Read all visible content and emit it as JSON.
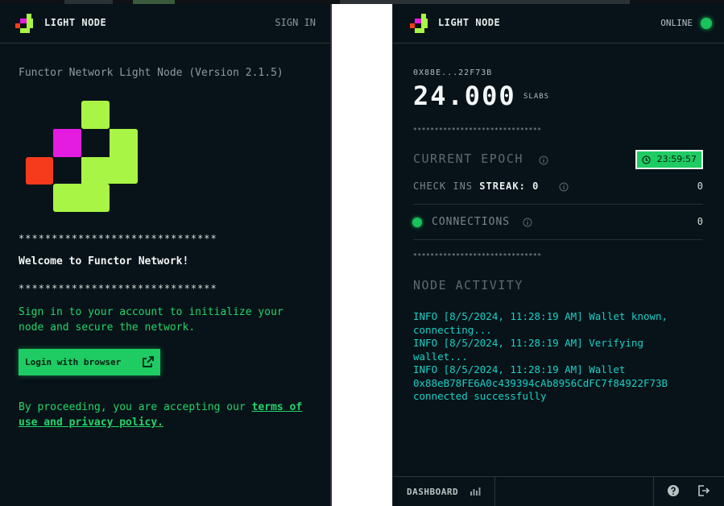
{
  "left": {
    "brand": "LIGHT NODE",
    "signin": "SIGN IN",
    "version": "Functor Network Light Node (Version 2.1.5)",
    "stars": "******************************",
    "welcome": "Welcome to Functor Network!",
    "description": "Sign in to your account to initialize your node and secure the network.",
    "login_label": "Login with browser",
    "consent_prefix": "By proceeding, you are accepting our ",
    "consent_link": "terms of use and privacy policy."
  },
  "right": {
    "brand": "LIGHT NODE",
    "status": "ONLINE",
    "address": "0X88E...22F73B",
    "balance": "24.000",
    "unit": "SLABS",
    "stars": "******************************",
    "epoch_label": "CURRENT EPOCH",
    "epoch_timer": "23:59:57",
    "checkins_label": "CHECK INS",
    "streak_label": "STREAK: 0",
    "checkins_value": "0",
    "connections_label": "CONNECTIONS",
    "connections_value": "0",
    "activity_title": "NODE ACTIVITY",
    "activity": [
      "INFO [8/5/2024, 11:28:19 AM] Wallet known, connecting...",
      "INFO [8/5/2024, 11:28:19 AM] Verifying wallet...",
      "INFO [8/5/2024, 11:28:19 AM] Wallet 0x88eB78FE6A0c439394cAb8956CdFC7f84922F73B connected successfully"
    ],
    "footer_dashboard": "DASHBOARD"
  },
  "colors": {
    "accent": "#1fcb63",
    "magenta": "#e41be0",
    "lime": "#a8f545",
    "orange": "#f53b1b",
    "log_cyan": "#19d1c9"
  },
  "icons": {
    "login": "external-link-icon",
    "timer": "clock-icon",
    "info": "info-icon",
    "dashboard": "bar-chart-icon",
    "help": "help-icon",
    "logout": "logout-icon"
  }
}
